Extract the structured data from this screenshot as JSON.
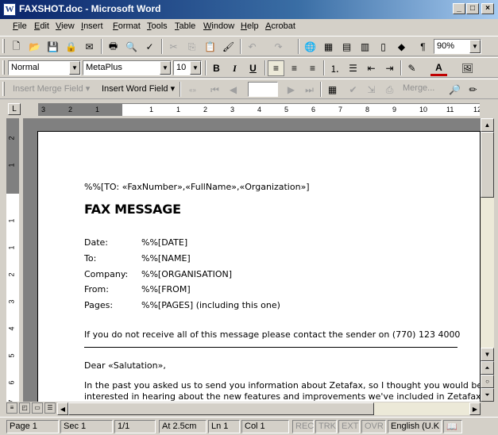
{
  "window": {
    "title": "FAXSHOT.doc - Microsoft Word",
    "app_icon_letter": "W",
    "minimize": "_",
    "maximize": "□",
    "close": "×"
  },
  "menu": [
    {
      "label": "File",
      "u": "F",
      "rest": "ile"
    },
    {
      "label": "Edit",
      "u": "E",
      "rest": "dit"
    },
    {
      "label": "View",
      "u": "V",
      "rest": "iew"
    },
    {
      "label": "Insert",
      "u": "I",
      "rest": "nsert"
    },
    {
      "label": "Format",
      "u": "F",
      "rest": "ormat"
    },
    {
      "label": "Tools",
      "u": "T",
      "rest": "ools"
    },
    {
      "label": "Table",
      "u": "T",
      "rest": "able"
    },
    {
      "label": "Window",
      "u": "W",
      "rest": "indow"
    },
    {
      "label": "Help",
      "u": "H",
      "rest": "elp"
    },
    {
      "label": "Acrobat",
      "u": "A",
      "rest": "crobat"
    }
  ],
  "standard_toolbar": {
    "zoom": "90%",
    "pilcrow": "¶"
  },
  "formatting_toolbar": {
    "style": "Normal",
    "font": "MetaPlus",
    "size": "10",
    "bold": "B",
    "italic": "I",
    "underline": "U",
    "font_color_letter": "A"
  },
  "mailmerge_toolbar": {
    "insert_merge_field": "Insert Merge Field",
    "insert_word_field": "Insert Word Field",
    "abc": "«»\nABC",
    "merge": "Merge..."
  },
  "ruler": {
    "h_numbers": [
      "3",
      "2",
      "1",
      "1",
      "1",
      "2",
      "3",
      "4",
      "5",
      "6",
      "7",
      "8",
      "9",
      "10",
      "11",
      "12",
      "13"
    ],
    "v_numbers": [
      "2",
      "1",
      "1",
      "1",
      "2",
      "3",
      "4",
      "5",
      "6",
      "7"
    ]
  },
  "document": {
    "merge_header": "%%[TO: «FaxNumber»,«FullName»,«Organization»]",
    "heading": "FAX MESSAGE",
    "fields": [
      {
        "label": "Date:",
        "value": "%%[DATE]"
      },
      {
        "label": "To:",
        "value": "%%[NAME]"
      },
      {
        "label": "Company:",
        "value": "%%[ORGANISATION]"
      },
      {
        "label": "From:",
        "value": "%%[FROM]"
      },
      {
        "label": "Pages:",
        "value": "%%[PAGES] (including this one)"
      }
    ],
    "notice": "If you do not receive all of this message please contact the sender on (770) 123 4000",
    "salutation": "Dear «Salutation»,",
    "body_line1": "In the past you asked us to send you information about Zetafax, so I thought you would be",
    "body_line2": "interested in hearing about the new features and improvements we've included in Zetafax."
  },
  "status": {
    "page": "Page  1",
    "sec": "Sec  1",
    "pages": "1/1",
    "at": "At  2.5cm",
    "ln": "Ln  1",
    "col": "Col  1",
    "rec": "REC",
    "trk": "TRK",
    "ext": "EXT",
    "ovr": "OVR",
    "lang": "English (U.K"
  }
}
